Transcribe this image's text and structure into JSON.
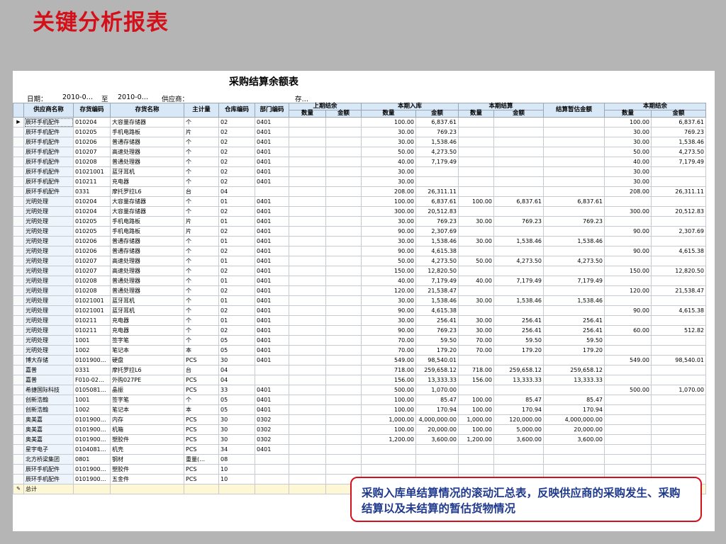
{
  "slide": {
    "title": "关键分析报表",
    "callout": "采购入库单结算情况的滚动汇总表，反映供应商的采购发生、采购结算以及未结算的暂估货物情况"
  },
  "report": {
    "title": "采购结算余额表",
    "filters": {
      "date_label": "日期：",
      "date_from": "2010-0…",
      "to_label": "至",
      "date_to": "2010-0…",
      "supplier_label": "供应商：",
      "inventory_label": "存…"
    },
    "columns": {
      "supplier": "供应商名称",
      "inv_code": "存货编码",
      "inv_name": "存货名称",
      "unit": "主计量",
      "wh_code": "仓库编码",
      "dept_code": "部门编码",
      "prev_group": "上期结余",
      "in_group": "本期入库",
      "settle_group": "本期结算",
      "estimated": "结算暂估金额",
      "end_group": "本期结余",
      "qty": "数量",
      "amt": "金额"
    },
    "rows": [
      [
        "辰环手机配件",
        "010204",
        "大容量存储器",
        "个",
        "02",
        "0401",
        "",
        "",
        "100.00",
        "6,837.61",
        "",
        "",
        "",
        "100.00",
        "6,837.61"
      ],
      [
        "辰环手机配件",
        "010205",
        "手机电路板",
        "片",
        "02",
        "0401",
        "",
        "",
        "30.00",
        "769.23",
        "",
        "",
        "",
        "30.00",
        "769.23"
      ],
      [
        "辰环手机配件",
        "010206",
        "普通存储器",
        "个",
        "02",
        "0401",
        "",
        "",
        "30.00",
        "1,538.46",
        "",
        "",
        "",
        "30.00",
        "1,538.46"
      ],
      [
        "辰环手机配件",
        "010207",
        "高速处理器",
        "个",
        "02",
        "0401",
        "",
        "",
        "50.00",
        "4,273.50",
        "",
        "",
        "",
        "50.00",
        "4,273.50"
      ],
      [
        "辰环手机配件",
        "010208",
        "普通处理器",
        "个",
        "02",
        "0401",
        "",
        "",
        "40.00",
        "7,179.49",
        "",
        "",
        "",
        "40.00",
        "7,179.49"
      ],
      [
        "辰环手机配件",
        "01021001",
        "蓝牙耳机",
        "个",
        "02",
        "0401",
        "",
        "",
        "30.00",
        "",
        "",
        "",
        "",
        "30.00",
        ""
      ],
      [
        "辰环手机配件",
        "010211",
        "充电器",
        "个",
        "02",
        "0401",
        "",
        "",
        "30.00",
        "",
        "",
        "",
        "",
        "30.00",
        ""
      ],
      [
        "辰环手机配件",
        "0331",
        "摩托罗拉L6",
        "台",
        "04",
        "",
        "",
        "",
        "208.00",
        "26,311.11",
        "",
        "",
        "",
        "208.00",
        "26,311.11"
      ],
      [
        "光明处理",
        "010204",
        "大容量存储器",
        "个",
        "01",
        "0401",
        "",
        "",
        "100.00",
        "6,837.61",
        "100.00",
        "6,837.61",
        "6,837.61",
        "",
        ""
      ],
      [
        "光明处理",
        "010204",
        "大容量存储器",
        "个",
        "02",
        "0401",
        "",
        "",
        "300.00",
        "20,512.83",
        "",
        "",
        "",
        "300.00",
        "20,512.83"
      ],
      [
        "光明处理",
        "010205",
        "手机电路板",
        "片",
        "01",
        "0401",
        "",
        "",
        "30.00",
        "769.23",
        "30.00",
        "769.23",
        "769.23",
        "",
        ""
      ],
      [
        "光明处理",
        "010205",
        "手机电路板",
        "片",
        "02",
        "0401",
        "",
        "",
        "90.00",
        "2,307.69",
        "",
        "",
        "",
        "90.00",
        "2,307.69"
      ],
      [
        "光明处理",
        "010206",
        "普通存储器",
        "个",
        "01",
        "0401",
        "",
        "",
        "30.00",
        "1,538.46",
        "30.00",
        "1,538.46",
        "1,538.46",
        "",
        ""
      ],
      [
        "光明处理",
        "010206",
        "普通存储器",
        "个",
        "02",
        "0401",
        "",
        "",
        "90.00",
        "4,615.38",
        "",
        "",
        "",
        "90.00",
        "4,615.38"
      ],
      [
        "光明处理",
        "010207",
        "高速处理器",
        "个",
        "01",
        "0401",
        "",
        "",
        "50.00",
        "4,273.50",
        "50.00",
        "4,273.50",
        "4,273.50",
        "",
        ""
      ],
      [
        "光明处理",
        "010207",
        "高速处理器",
        "个",
        "02",
        "0401",
        "",
        "",
        "150.00",
        "12,820.50",
        "",
        "",
        "",
        "150.00",
        "12,820.50"
      ],
      [
        "光明处理",
        "010208",
        "普通处理器",
        "个",
        "01",
        "0401",
        "",
        "",
        "40.00",
        "7,179.49",
        "40.00",
        "7,179.49",
        "7,179.49",
        "",
        ""
      ],
      [
        "光明处理",
        "010208",
        "普通处理器",
        "个",
        "02",
        "0401",
        "",
        "",
        "120.00",
        "21,538.47",
        "",
        "",
        "",
        "120.00",
        "21,538.47"
      ],
      [
        "光明处理",
        "01021001",
        "蓝牙耳机",
        "个",
        "01",
        "0401",
        "",
        "",
        "30.00",
        "1,538.46",
        "30.00",
        "1,538.46",
        "1,538.46",
        "",
        ""
      ],
      [
        "光明处理",
        "01021001",
        "蓝牙耳机",
        "个",
        "02",
        "0401",
        "",
        "",
        "90.00",
        "4,615.38",
        "",
        "",
        "",
        "90.00",
        "4,615.38"
      ],
      [
        "光明处理",
        "010211",
        "充电器",
        "个",
        "01",
        "0401",
        "",
        "",
        "30.00",
        "256.41",
        "30.00",
        "256.41",
        "256.41",
        "",
        ""
      ],
      [
        "光明处理",
        "010211",
        "充电器",
        "个",
        "02",
        "0401",
        "",
        "",
        "90.00",
        "769.23",
        "30.00",
        "256.41",
        "256.41",
        "60.00",
        "512.82"
      ],
      [
        "光明处理",
        "1001",
        "签字笔",
        "个",
        "05",
        "0401",
        "",
        "",
        "70.00",
        "59.50",
        "70.00",
        "59.50",
        "59.50",
        "",
        ""
      ],
      [
        "光明处理",
        "1002",
        "笔记本",
        "本",
        "05",
        "0401",
        "",
        "",
        "70.00",
        "179.20",
        "70.00",
        "179.20",
        "179.20",
        "",
        ""
      ],
      [
        "博大存储",
        "0101900…",
        "硬盘",
        "PCS",
        "30",
        "0401",
        "",
        "",
        "549.00",
        "98,540.01",
        "",
        "",
        "",
        "549.00",
        "98,540.01"
      ],
      [
        "嘉普",
        "0331",
        "摩托罗拉L6",
        "台",
        "04",
        "",
        "",
        "",
        "718.00",
        "259,658.12",
        "718.00",
        "259,658.12",
        "259,658.12",
        "",
        ""
      ],
      [
        "嘉普",
        "F010-02…",
        "外购027PE",
        "PCS",
        "04",
        "",
        "",
        "",
        "156.00",
        "13,333.33",
        "156.00",
        "13,333.33",
        "13,333.33",
        "",
        ""
      ],
      [
        "希捷国际科技",
        "0105081…",
        "晶振",
        "PCS",
        "33",
        "0401",
        "",
        "",
        "500.00",
        "1,070.00",
        "",
        "",
        "",
        "500.00",
        "1,070.00"
      ],
      [
        "创新浩翰",
        "1001",
        "签字笔",
        "个",
        "05",
        "0401",
        "",
        "",
        "100.00",
        "85.47",
        "100.00",
        "85.47",
        "85.47",
        "",
        ""
      ],
      [
        "创新浩翰",
        "1002",
        "笔记本",
        "本",
        "05",
        "0401",
        "",
        "",
        "100.00",
        "170.94",
        "100.00",
        "170.94",
        "170.94",
        "",
        ""
      ],
      [
        "奥美嘉",
        "0101900…",
        "内存",
        "PCS",
        "30",
        "0302",
        "",
        "",
        "1,000.00",
        "4,000,000.00",
        "1,000.00",
        "120,000.00",
        "4,000,000.00",
        "",
        ""
      ],
      [
        "奥美嘉",
        "0101900…",
        "机箱",
        "PCS",
        "30",
        "0302",
        "",
        "",
        "100.00",
        "20,000.00",
        "100.00",
        "5,000.00",
        "20,000.00",
        "",
        ""
      ],
      [
        "奥美嘉",
        "0101900…",
        "塑胶件",
        "PCS",
        "30",
        "0302",
        "",
        "",
        "1,200.00",
        "3,600.00",
        "1,200.00",
        "3,600.00",
        "3,600.00",
        "",
        ""
      ],
      [
        "星宇电子",
        "0104081…",
        "机壳",
        "PCS",
        "34",
        "0401",
        "",
        "",
        "",
        "",
        "",
        "",
        "",
        "",
        ""
      ],
      [
        "北方桥梁集团",
        "0801",
        "钢材",
        "重量(…",
        "08",
        "",
        "",
        "",
        "",
        "",
        "",
        "",
        "",
        "",
        ""
      ],
      [
        "辰环手机配件",
        "0101900…",
        "塑胶件",
        "PCS",
        "10",
        "",
        "",
        "",
        "",
        "",
        "",
        "",
        "",
        "",
        ""
      ],
      [
        "辰环手机配件",
        "0101900…",
        "五金件",
        "PCS",
        "10",
        "",
        "",
        "",
        "",
        "",
        "",
        "",
        "",
        "",
        ""
      ]
    ],
    "total_label": "总计"
  }
}
